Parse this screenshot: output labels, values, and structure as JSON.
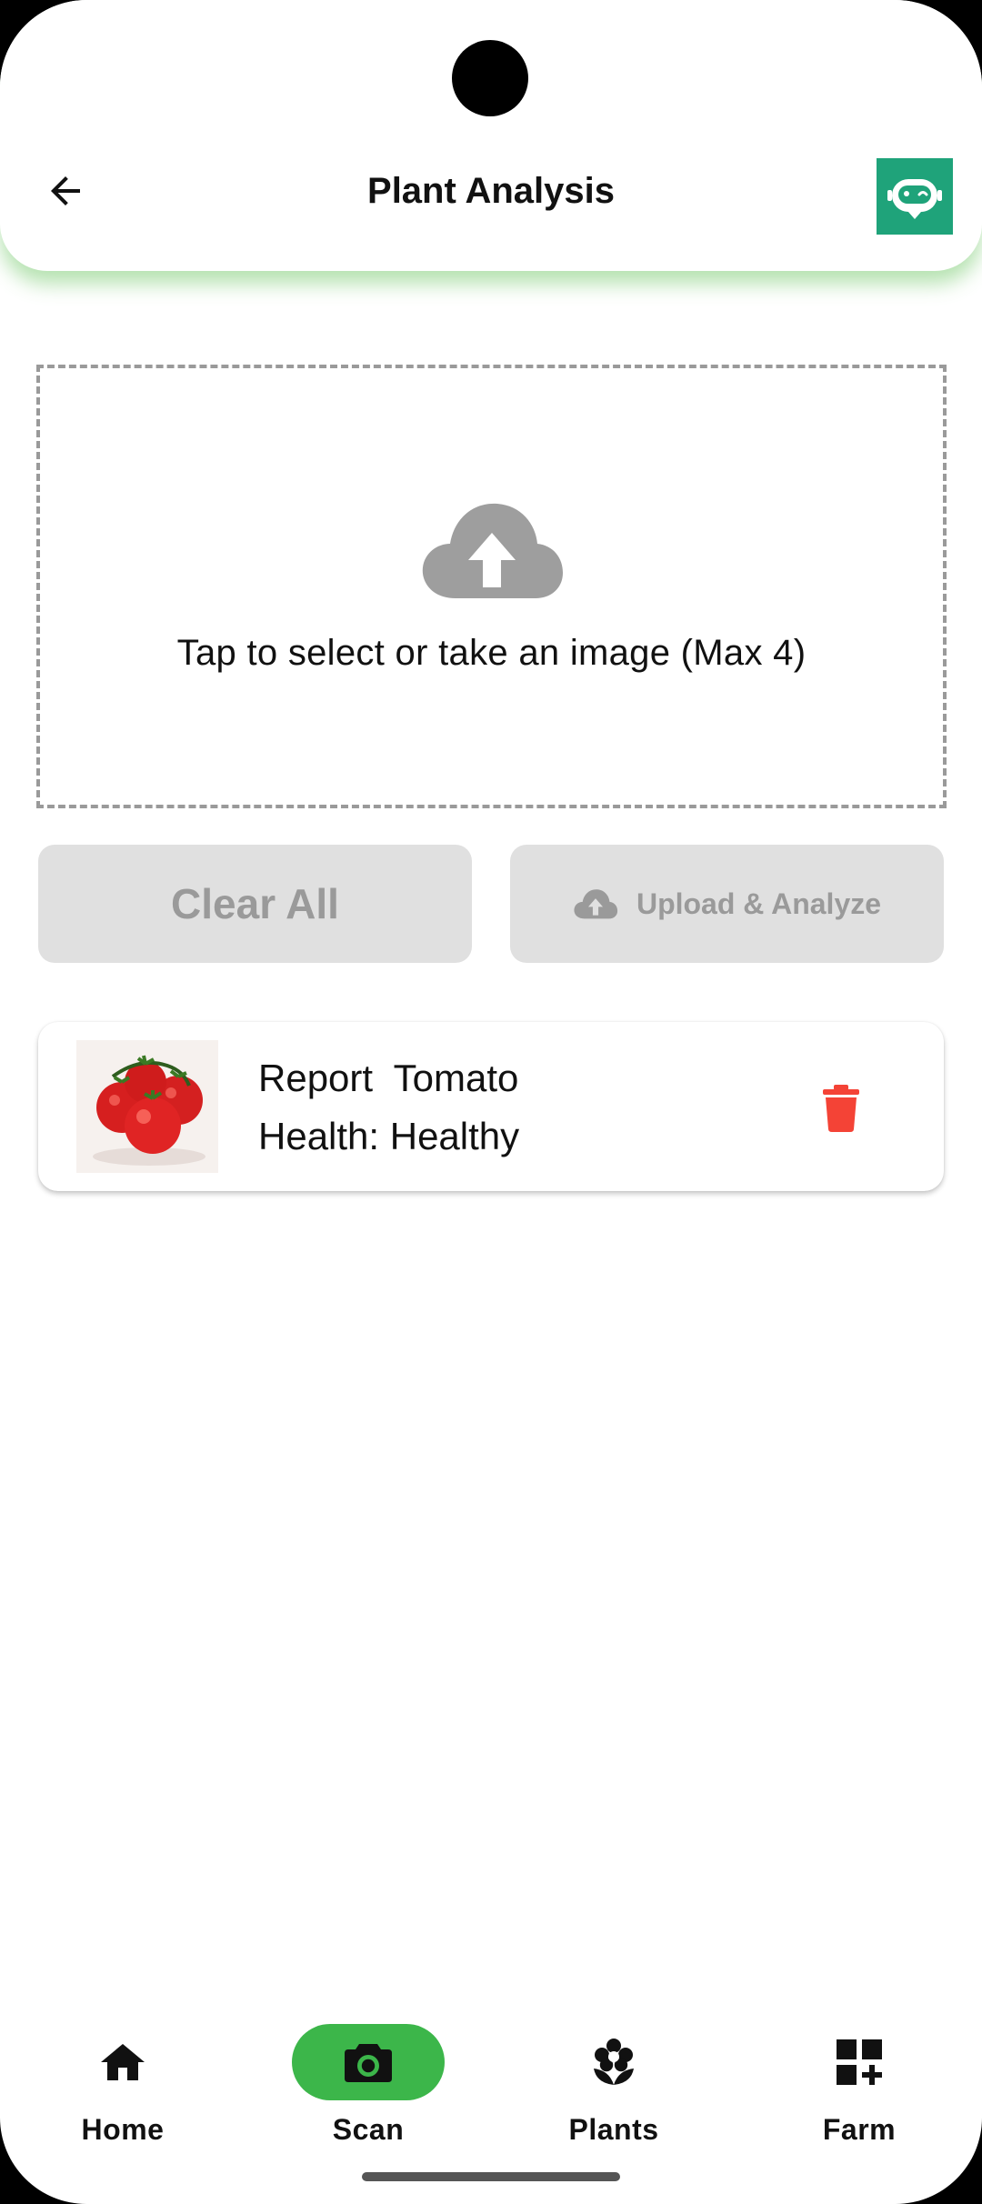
{
  "appbar": {
    "title": "Plant Analysis"
  },
  "dropzone": {
    "text": "Tap to select or take an image (Max 4)"
  },
  "actions": {
    "clear_label": "Clear All",
    "upload_label": "Upload & Analyze"
  },
  "reports": [
    {
      "title": "Report  Tomato",
      "health": "Health: Healthy",
      "image": "tomato-photo"
    }
  ],
  "nav": {
    "items": [
      {
        "label": "Home",
        "icon": "home-icon"
      },
      {
        "label": "Scan",
        "icon": "camera-icon",
        "active": true
      },
      {
        "label": "Plants",
        "icon": "flower-icon"
      },
      {
        "label": "Farm",
        "icon": "grid-plus-icon"
      }
    ]
  },
  "colors": {
    "accent": "#3cb64a",
    "bot_button": "#1fa37a",
    "delete": "#f44336",
    "disabled_bg": "#e0e0e0",
    "disabled_text": "#9a9a9a"
  }
}
